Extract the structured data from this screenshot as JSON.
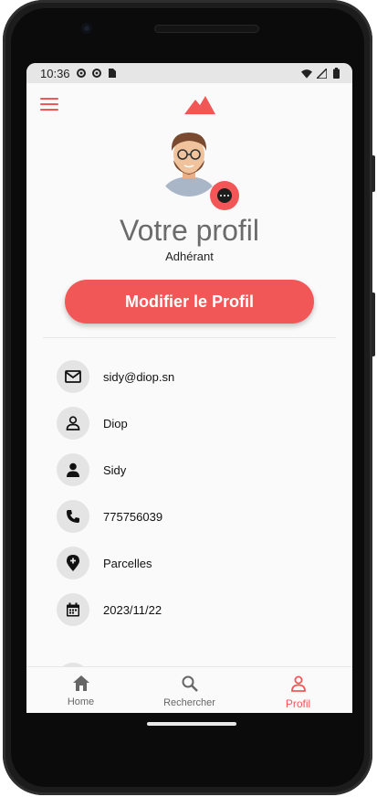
{
  "status_bar": {
    "time": "10:36",
    "left_icons": [
      "settings-icon",
      "settings-icon",
      "sim-card-icon"
    ],
    "right_icons": [
      "wifi-icon",
      "signal-icon",
      "battery-icon"
    ]
  },
  "header": {
    "menu_icon": "menu-icon",
    "logo_icon": "mountains-logo"
  },
  "profile": {
    "title": "Votre profil",
    "role": "Adhérant",
    "avatar": "bearded-man-avatar",
    "badge_icon": "more-options-icon"
  },
  "edit_button": {
    "label": "Modifier le Profil"
  },
  "info": [
    {
      "icon": "mail-icon",
      "value": "sidy@diop.sn"
    },
    {
      "icon": "person-outline-icon",
      "value": "Diop"
    },
    {
      "icon": "person-filled-icon",
      "value": "Sidy"
    },
    {
      "icon": "phone-icon",
      "value": "775756039"
    },
    {
      "icon": "location-pin-icon",
      "value": "Parcelles"
    },
    {
      "icon": "calendar-icon",
      "value": "2023/11/22"
    }
  ],
  "nav": [
    {
      "label": "Home",
      "icon": "home-icon",
      "active": false
    },
    {
      "label": "Rechercher",
      "icon": "search-icon",
      "active": false
    },
    {
      "label": "Profil",
      "icon": "person-outline-icon",
      "active": true
    }
  ],
  "colors": {
    "accent": "#f25757",
    "background": "#fafafa",
    "icon_circle": "#e4e4e4",
    "title_text": "#6b6b6b"
  }
}
